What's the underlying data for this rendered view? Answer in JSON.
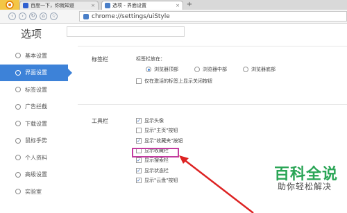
{
  "browser": {
    "tabs": [
      {
        "label": "百度一下，你就知道",
        "close": "×"
      },
      {
        "label": "选项 - 界面设置",
        "close": "×"
      }
    ],
    "newtab": "+",
    "nav": {
      "back": "‹",
      "forward": "›",
      "reload": "↻",
      "home": "⌂",
      "star": "☆"
    },
    "url": "chrome://settings/uiStyle"
  },
  "page": {
    "title": "选项"
  },
  "sidebar": {
    "items": [
      {
        "label": "基本设置",
        "icon": "gear-icon"
      },
      {
        "label": "界面设置",
        "icon": "layout-icon",
        "active": true
      },
      {
        "label": "标签设置",
        "icon": "tab-icon"
      },
      {
        "label": "广告拦截",
        "icon": "block-icon"
      },
      {
        "label": "下载设置",
        "icon": "download-icon"
      },
      {
        "label": "鼠标手势",
        "icon": "mouse-icon"
      },
      {
        "label": "个人资料",
        "icon": "user-icon"
      },
      {
        "label": "高级设置",
        "icon": "advanced-icon"
      },
      {
        "label": "实验室",
        "icon": "lab-icon"
      }
    ]
  },
  "tabbar_section": {
    "label": "标签栏",
    "position_label": "标签栏放在：",
    "options": [
      "浏览器顶部",
      "浏览器中部",
      "浏览器底部"
    ],
    "selected": 0,
    "close_option": "仅在激活的标签上显示关闭按钮"
  },
  "toolbar_section": {
    "label": "工具栏",
    "items": [
      {
        "label": "显示头像",
        "checked": true
      },
      {
        "label": "显示\"主页\"按钮",
        "checked": false
      },
      {
        "label": "显示\"收藏夹\"按钮",
        "checked": true
      },
      {
        "label": "显示收藏栏",
        "checked": false
      },
      {
        "label": "显示搜索栏",
        "checked": true
      },
      {
        "label": "显示状态栏",
        "checked": true
      },
      {
        "label": "显示\"云盘\"按钮",
        "checked": true
      }
    ]
  },
  "watermark": {
    "title": "百科全说",
    "subtitle": "助你轻松解决"
  },
  "colors": {
    "accent": "#3d82d8",
    "highlight": "#c23ca0",
    "watermark": "#2aa556"
  }
}
